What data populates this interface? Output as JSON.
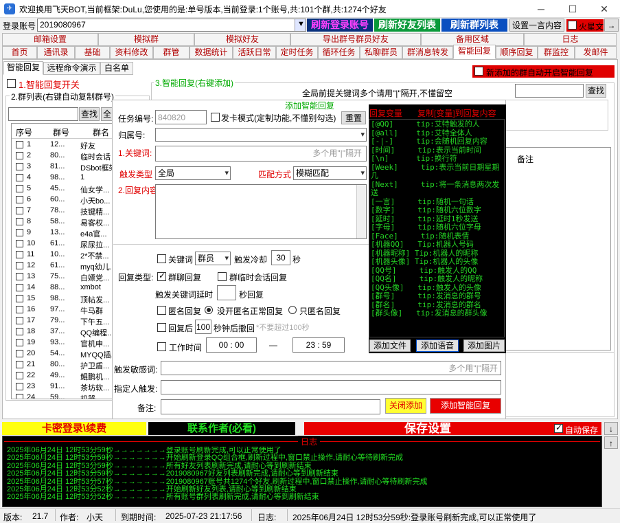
{
  "window": {
    "title": "欢迎换用飞天BOT,当前框架:DuLu,您使用的是:单号版本,当前登录:1个账号,共:101个群,共:1274个好友",
    "icon": "app-icon"
  },
  "account_row": {
    "label": "登录账号",
    "value": "2019080967",
    "refresh_login": "刷新登录账号",
    "refresh_friends": "刷新好友列表",
    "refresh_groups": "刷新群列表",
    "set_one_line": "设置一言内容",
    "mars_label": "火星文"
  },
  "top_tabs": [
    "邮箱设置",
    "模拟群",
    "模拟好友",
    "导出群号群员好友",
    "备用区域",
    "日志"
  ],
  "main_tabs": [
    "首页",
    "通讯录",
    "基础",
    "资料修改",
    "群管",
    "数据统计",
    "活跃日常",
    "定时任务",
    "循环任务",
    "私聊群员",
    "群消息转发",
    "智能回复",
    "顺序回复",
    "群监控",
    "发邮件"
  ],
  "sub_tabs": [
    "智能回复",
    "远程命令演示",
    "白名单"
  ],
  "left": {
    "switch_label": "1.智能回复开关",
    "group_list_title": "2.群列表(右键自动复制群号)",
    "search_btn": "查找",
    "all_btn": "全",
    "columns": [
      "序号",
      "群号",
      "群名"
    ],
    "rows": [
      [
        "1",
        "12...",
        "好友"
      ],
      [
        "2",
        "80...",
        "临时会话"
      ],
      [
        "3",
        "81...",
        "DSbot框架"
      ],
      [
        "4",
        "98...",
        "1"
      ],
      [
        "5",
        "45...",
        "仙女学..."
      ],
      [
        "6",
        "60...",
        "小天bo..."
      ],
      [
        "7",
        "78...",
        "技键精..."
      ],
      [
        "8",
        "58...",
        "易客权..."
      ],
      [
        "9",
        "13...",
        "e4a官..."
      ],
      [
        "10",
        "61...",
        "尿尿拉..."
      ],
      [
        "11",
        "10...",
        "2*不禁..."
      ],
      [
        "12",
        "61...",
        "myq幼儿..."
      ],
      [
        "13",
        "75...",
        "白嫖党..."
      ],
      [
        "14",
        "88...",
        "xmbot"
      ],
      [
        "15",
        "98...",
        "顶帖发..."
      ],
      [
        "16",
        "97...",
        "牛马群"
      ],
      [
        "17",
        "79...",
        "下午五..."
      ],
      [
        "18",
        "37...",
        "QQ编程..."
      ],
      [
        "19",
        "93...",
        "官机申..."
      ],
      [
        "20",
        "54...",
        "MYQQ插..."
      ],
      [
        "21",
        "80...",
        "护卫盾..."
      ],
      [
        "22",
        "49...",
        "鲲鹏机..."
      ],
      [
        "23",
        "91...",
        "茶坊软..."
      ],
      [
        "24",
        "59...",
        "机器..."
      ]
    ]
  },
  "right": {
    "section_title": "3.智能回复(右键添加)",
    "new_group_toggle": "新添加的群自动开启智能回复",
    "global_keyword_label": "全局前提关键词多个请用\"|\"隔开,不懂留空",
    "search_btn": "查找",
    "remark_col": "备注"
  },
  "dialog": {
    "title": "添加智能回复",
    "task_id_label": "任务编号:",
    "task_id_value": "840820",
    "card_mode": "发卡模式(定制功能,不懂别勾选)",
    "reset_btn": "重置",
    "owner_label": "归属号:",
    "keyword_label": "1.关键词:",
    "keyword_placeholder": "多个用\"|\"隔开",
    "trigger_type_label": "触发类型",
    "trigger_type_value": "全局",
    "match_label": "匹配方式",
    "match_value": "模糊匹配",
    "content_label": "2.回复内容:",
    "keyword_cb": "关键词",
    "member_select": "群员",
    "cooldown_label": "触发冷却",
    "cooldown_value": "30",
    "seconds": "秒",
    "reply_type_label": "回复类型:",
    "group_reply": "群聊回复",
    "temp_reply": "群临时会话回复",
    "delay_label": "触发关键词延时",
    "delay_unit": "秒回复",
    "anon_cb": "匿名回复",
    "anon_opt1": "没开匿名正常回复",
    "anon_opt2": "只匿名回复",
    "recall_cb": "回复后",
    "recall_value": "100",
    "recall_unit": "秒钟后撤回",
    "recall_hint": "*不要超过100秒",
    "work_time_cb": "工作时间",
    "time_start": "00 : 00",
    "time_end": "23 : 59",
    "time_dash": "—",
    "sensitive_label": "触发敏感词:",
    "sensitive_placeholder": "多个用\"|\"隔开",
    "person_label": "指定人触发:",
    "remark_label": "备注:",
    "close_btn": "关闭添加",
    "add_btn": "添加智能回复",
    "var_header": "回复变量",
    "var_copy": "复制[变量]到回复内容",
    "add_file": "添加文件",
    "add_voice": "添加语音",
    "add_image": "添加图片",
    "variables": [
      "[@QQ]     tip:艾特触发的人",
      "[@all]    tip:艾特全体人",
      "[-|-]     tip:会随机回复内容",
      "[时间]     tip:表示当前时间",
      "[\\n]      tip:换行符",
      "[Week]     tip:表示当前日期星期",
      "几",
      "[Next]     tip:将一条消息两次发",
      "送",
      "[一言]     tip:随机一句话",
      "[数字]     tip:随机六位数字",
      "[延时]     tip:延时1秒发送",
      "[字母]     tip:随机六位字母",
      "[Face]     tip:随机表情",
      "[机器QQ]   Tip:机器人号码",
      "[机器昵称] Tip:机器人的昵称",
      "[机器头像] Tip:机器人的头像",
      "[QQ号]     tip:触发人的QQ",
      "[QQ名]     tip:触发人的昵称",
      "[QQ头像]   tip:触发人的头像",
      "[群号]     tip:发消息的群号",
      "[群名]     tip:发消息的群名",
      "[群头像]   tip:发消息的群头像"
    ]
  },
  "bottom": {
    "card_login": "卡密登录\\续费",
    "contact_author": "联系作者(必看)",
    "save_settings": "保存设置",
    "auto_save": "自动保存",
    "log_title": "日志",
    "logs": [
      "2025年06月24日  12时53分59秒→→→→→→→登录账号刷新完成,可以正常使用了",
      "2025年06月24日  12时53分59秒→→→→→→→开始刷新登录QQ组合框,刷新过程中,窗口禁止操作,请耐心等待刷新完成",
      "2025年06月24日  12时53分59秒→→→→→→→所有好友列表刷新完成,请耐心等到刷新结束",
      "2025年06月24日  12时53分59秒→→→→→→→2019080967好友列表刷新完成,请耐心等到刷新结束",
      "2025年06月24日  12时53分57秒→→→→→→→2019080967账号共1274个好友,刷新过程中,窗口禁止操作,请耐心等待刷新完成",
      "2025年06月24日  12时53分52秒→→→→→→→开始刷新好友列表,请耐心等到刷新结束",
      "2025年06月24日  12时53分52秒→→→→→→→所有账号群列表刷新完成,请耐心等到刷新结束"
    ]
  },
  "status": {
    "version_label": "版本:",
    "version": "21.7",
    "author_label": "作者:",
    "author": "小天",
    "expire_label": "到期时间:",
    "expire": "2025-07-23 21:17:56",
    "log_label": "日志:",
    "log": "2025年06月24日 12时53分59秒:登录账号刷新完成,可以正常使用了"
  }
}
